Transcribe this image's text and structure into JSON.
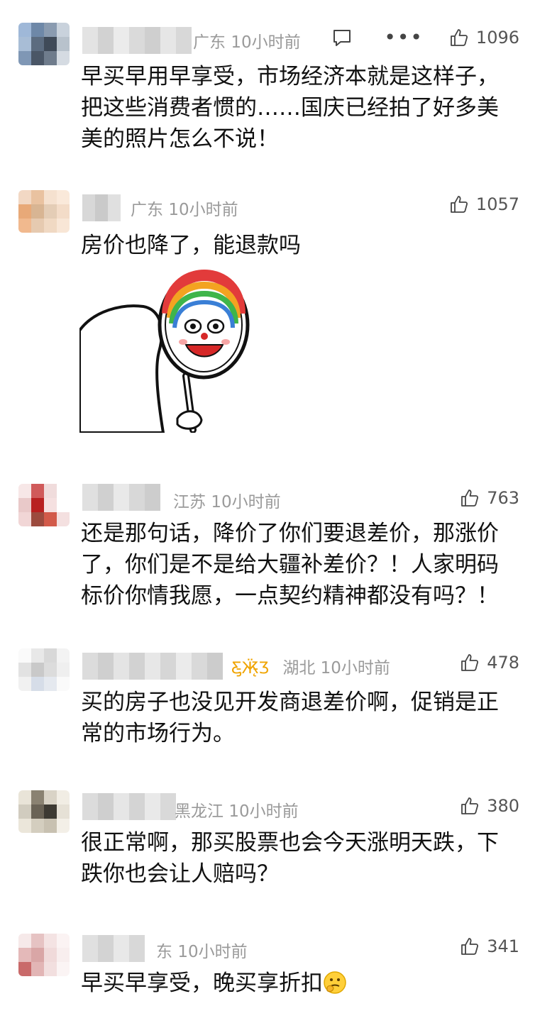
{
  "comments": [
    {
      "location": "广东",
      "time": "10小时前",
      "likes": "1096",
      "text": "早买早用早享受，市场经济本就是这样子，把这些消费者惯的……国庆已经拍了好多美美的照片怎么不说！",
      "show_reply_more": true
    },
    {
      "location": "广东",
      "time": "10小时前",
      "likes": "1057",
      "text": "房价也降了，能退款吗",
      "sticker": "clown-mirror-sticker"
    },
    {
      "location": "江苏",
      "time": "10小时前",
      "likes": "763",
      "text": "还是那句话，降价了你们要退差价，那涨价了，你们是不是给大疆补差价？！人家明码标价你情我愿，一点契约精神都没有吗？！"
    },
    {
      "location": "湖北",
      "time": "10小时前",
      "likes": "478",
      "text": "买的房子也没见开发商退差价啊，促销是正常的市场行为。",
      "vip_icon": "butterfly-icon"
    },
    {
      "location": "黑龙江",
      "time": "10小时前",
      "likes": "380",
      "text": "很正常啊，那买股票也会今天涨明天跌，下跌你也会让人赔吗？"
    },
    {
      "location": "东",
      "time": "10小时前",
      "likes": "341",
      "text": "早买早享受，晚买享折扣",
      "emoji": "thinking-face-emoji"
    }
  ],
  "colors": {
    "meta": "#9a9a9a",
    "text": "#111111",
    "vip": "#f0a400"
  }
}
